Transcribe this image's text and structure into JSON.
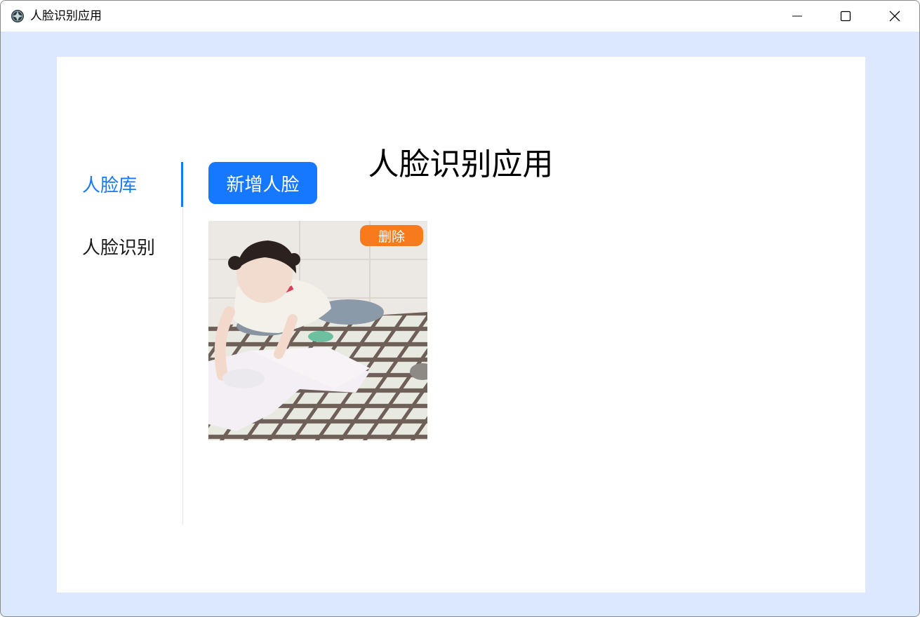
{
  "window": {
    "title": "人脸识别应用",
    "buttons": [
      "minimize-icon",
      "maximize-icon",
      "close-icon"
    ]
  },
  "page": {
    "title": "人脸识别应用"
  },
  "sidebar": {
    "items": [
      {
        "label": "人脸库",
        "active": true
      },
      {
        "label": "人脸识别",
        "active": false
      }
    ]
  },
  "main": {
    "add_label": "新增人脸",
    "faces": [
      {
        "delete_label": "删除",
        "photo": "face-photo"
      }
    ]
  },
  "colors": {
    "accent": "#1677ff",
    "delete": "#f77a1d",
    "background": "#dbe8fd"
  }
}
